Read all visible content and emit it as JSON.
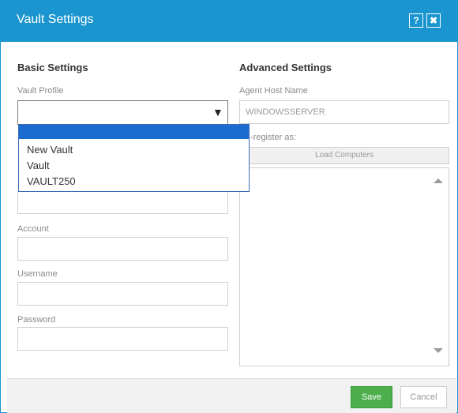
{
  "dialog": {
    "title": "Vault Settings",
    "help_label": "?",
    "close_label": "✖"
  },
  "basic": {
    "heading": "Basic Settings",
    "vault_profile_label": "Vault Profile",
    "vault_profile_value": "",
    "dropdown_arrow": "▼",
    "options": [
      "New Vault",
      "Vault",
      "VAULT250"
    ],
    "account_label": "Account",
    "account_value": "",
    "username_label": "Username",
    "username_value": "",
    "password_label": "Password",
    "password_value": ""
  },
  "advanced": {
    "heading": "Advanced Settings",
    "agent_host_label": "Agent Host Name",
    "agent_host_value": "WINDOWSSERVER",
    "register_label": "-register as:",
    "load_computers_label": "Load Computers"
  },
  "footer": {
    "save_label": "Save",
    "cancel_label": "Cancel"
  },
  "colors": {
    "titlebar": "#1a95cf",
    "save": "#4cae4c",
    "highlight": "#1c6ccf"
  }
}
